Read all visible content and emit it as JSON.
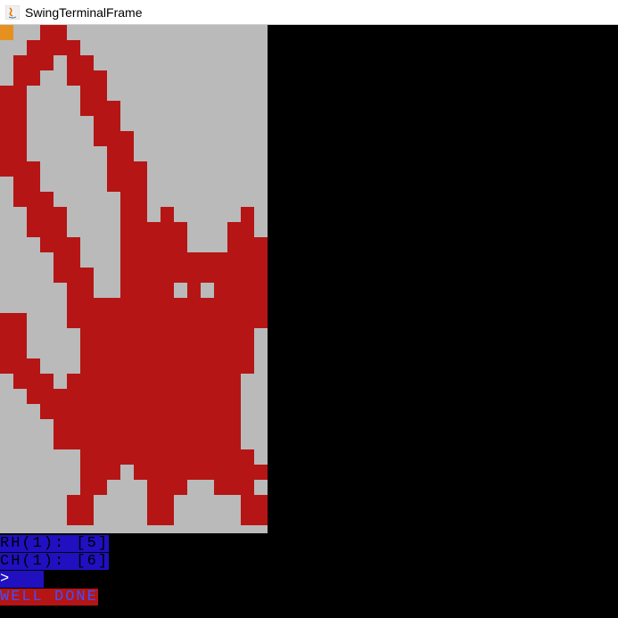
{
  "window": {
    "title": "SwingTerminalFrame",
    "icon": "java-icon"
  },
  "colors": {
    "cat_fg": "#b51515",
    "gray_bg": "#bababa",
    "orange": "#e69020",
    "blue_bg": "#2010c0",
    "blue_fg": "#4050ff",
    "red_bg": "#b51515"
  },
  "pixel_art": {
    "width_cells": 20,
    "height_cells": 33,
    "rows": [
      "00011000000000000000",
      "00111100000000000000",
      "01110110000000000000",
      "01100111000000000000",
      "11000011000000000000",
      "11000011100000000000",
      "11000001100000000000",
      "11000001110000000000",
      "11000000110000000000",
      "11100000111000000000",
      "01100000111000000000",
      "01110000011000000000",
      "00111000011010000010",
      "00111000011111000110",
      "00011100011111000111",
      "00001100011111111111",
      "00001110011111111111",
      "00000110011110101111",
      "00000111111111111111",
      "11000111111111111111",
      "11000011111111111110",
      "11000011111111111110",
      "11100011111111111110",
      "01110111111111111100",
      "00111111111111111100",
      "00011111111111111100",
      "00001111111111111100",
      "00001111111111111100",
      "00000011111111111110",
      "00000011101111111111",
      "00000011000111001110",
      "00000110000110000011",
      "00000110000110000011"
    ]
  },
  "terminal": {
    "lines": [
      {
        "text": "RH(1): [5]",
        "bg": "blue",
        "fg": "black"
      },
      {
        "text": "CH(1): [6]",
        "bg": "blue",
        "fg": "black"
      },
      {
        "text": ">   ",
        "bg": "blue",
        "fg": "white"
      },
      {
        "text": "WELL DONE",
        "bg": "red",
        "fg": "blue"
      }
    ]
  }
}
